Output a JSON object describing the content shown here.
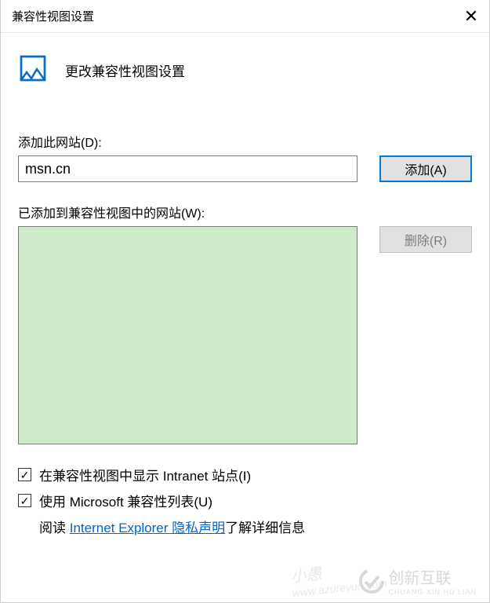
{
  "dialog": {
    "title": "兼容性视图设置",
    "header": "更改兼容性视图设置"
  },
  "add_section": {
    "label": "添加此网站(D):",
    "value": "msn.cn",
    "button": "添加(A)"
  },
  "list_section": {
    "label": "已添加到兼容性视图中的网站(W):",
    "remove_button": "删除(R)",
    "items": []
  },
  "options": {
    "intranet": {
      "checked": true,
      "label": "在兼容性视图中显示 Intranet 站点(I)"
    },
    "ms_list": {
      "checked": true,
      "label": "使用 Microsoft 兼容性列表(U)"
    }
  },
  "privacy": {
    "prefix": "阅读 ",
    "link": "Internet Explorer 隐私声明",
    "suffix": "了解详细信息"
  },
  "watermarks": {
    "left_line1": "小愚",
    "left_line2": "www.azureyun.com",
    "right_main": "创新互联",
    "right_sub": "CHUANG XIN HU LIAN"
  }
}
